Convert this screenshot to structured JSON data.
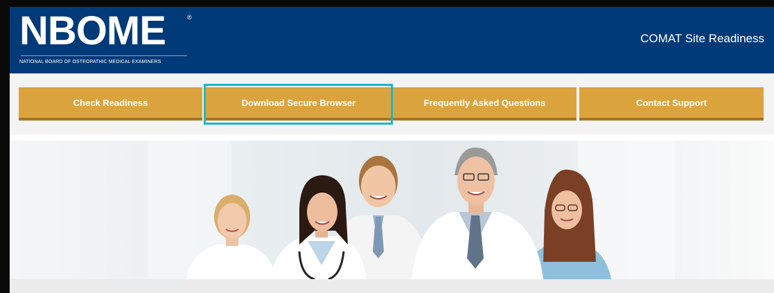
{
  "header": {
    "logo_text": "NBOME",
    "logo_registered": "®",
    "logo_subtitle": "NATIONAL BOARD OF OSTEOPATHIC MEDICAL EXAMINERS",
    "site_title": "COMAT Site Readiness"
  },
  "nav": {
    "items": [
      {
        "label": "Check Readiness"
      },
      {
        "label": "Download Secure Browser",
        "highlighted": true
      },
      {
        "label": "Frequently Asked Questions"
      },
      {
        "label": "Contact Support"
      }
    ],
    "button_color": "#dba33e",
    "highlight_color": "#1ab8c4"
  },
  "hero": {
    "image": "group of five smiling medical professionals in white coats and scrubs"
  },
  "colors": {
    "header_bg": "#003a78",
    "nav_bg": "#f3f3f3"
  }
}
